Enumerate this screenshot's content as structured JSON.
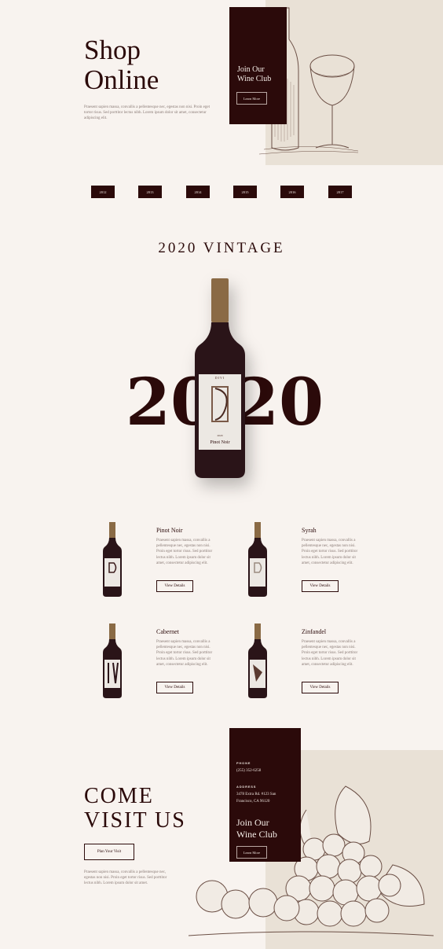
{
  "hero": {
    "title_line1": "Shop",
    "title_line2": "Online",
    "body": "Praesent sapien massa, convallis a pellentesque nec, egestas non nisi. Proin eget tortor risus. Sed porttitor lectus nibh. Lorem ipsum dolor sit amet, consectetur adipiscing elit.",
    "club_title_line1": "Join Our",
    "club_title_line2": "Wine Club",
    "club_button": "Learn More"
  },
  "years": [
    "2012",
    "2013",
    "2014",
    "2015",
    "2016",
    "2017"
  ],
  "vintage": {
    "heading": "2020 VINTAGE",
    "big_left": "20",
    "big_right": "20",
    "label_brand": "DIVI",
    "label_year": "2020",
    "label_name": "Pinot Noir"
  },
  "wines": [
    {
      "name": "Pinot Noir",
      "desc": "Praesent sapien massa, convallis a pellentesque nec, egestas non nisi. Proin eget tortor risus. Sed porttitor lectus nibh. Lorem ipsum dolor sit amet, consectetur adipiscing elit.",
      "button": "View Details"
    },
    {
      "name": "Syrah",
      "desc": "Praesent sapien massa, convallis a pellentesque nec, egestas non nisi. Proin eget tortor risus. Sed porttitor lectus nibh. Lorem ipsum dolor sit amet, consectetur adipiscing elit.",
      "button": "View Details"
    },
    {
      "name": "Cabernet",
      "desc": "Praesent sapien massa, convallis a pellentesque nec, egestas non nisi. Proin eget tortor risus. Sed porttitor lectus nibh. Lorem ipsum dolor sit amet, consectetur adipiscing elit.",
      "button": "View Details"
    },
    {
      "name": "Zinfandel",
      "desc": "Praesent sapien massa, convallis a pellentesque nec, egestas non nisi. Proin eget tortor risus. Sed porttitor lectus nibh. Lorem ipsum dolor sit amet, consectetur adipiscing elit.",
      "button": "View Details"
    }
  ],
  "visit": {
    "title_line1": "COME",
    "title_line2": "VISIT US",
    "button": "Plan Your Visit",
    "body": "Praesent sapien massa, convallis a pellentesque nec, egestas non nisi. Proin eget tortor risus. Sed porttitor lectus nibh. Lorem ipsum dolor sit amet.",
    "phone_label": "PHONE",
    "phone": "(255) 352-6258",
    "address_label": "ADDRESS",
    "address_line1": "3478 Extra Rd. #123 San",
    "address_line2": "Francisco, CA 96120",
    "club_title_line1": "Join Our",
    "club_title_line2": "Wine Club",
    "club_button": "Learn More"
  },
  "colors": {
    "maroon": "#2b0a0a",
    "cream": "#f8f3ef",
    "beige": "#e9e1d6"
  }
}
